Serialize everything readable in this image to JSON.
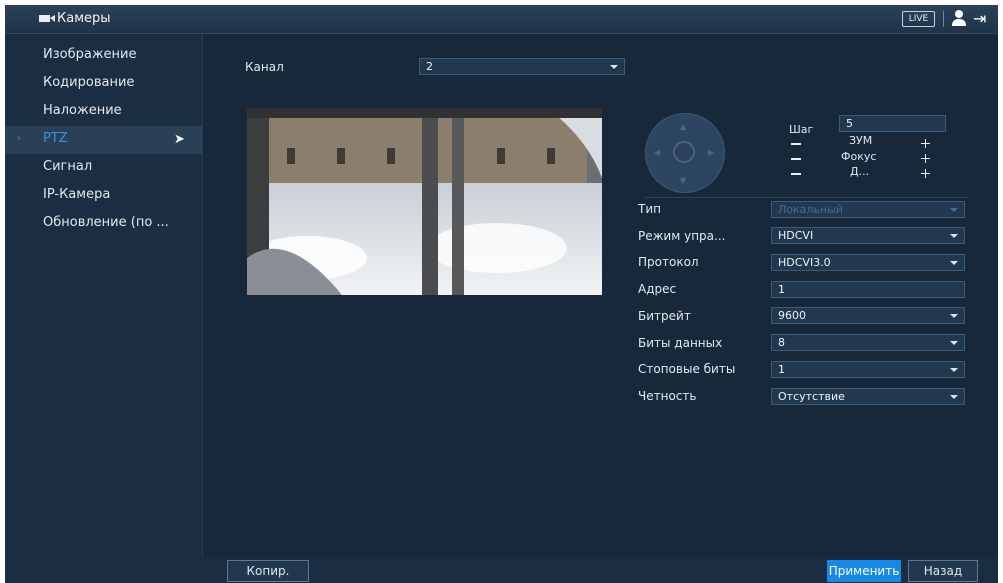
{
  "header": {
    "title": "Камеры",
    "live_label": "LIVE",
    "camera_icon": "video-camera-icon",
    "user_icon": "user-icon",
    "logout_icon": "logout-icon"
  },
  "sidebar": {
    "items": [
      {
        "label": "Изображение"
      },
      {
        "label": "Кодирование"
      },
      {
        "label": "Наложение"
      },
      {
        "label": "PTZ",
        "active": true
      },
      {
        "label": "Сигнал"
      },
      {
        "label": "IP-Камера"
      },
      {
        "label": "Обновление (по ..."
      }
    ]
  },
  "channel": {
    "label": "Канал",
    "value": "2"
  },
  "ptz_panel": {
    "step_label": "Шаг",
    "step_value": "5",
    "zoom_label": "ЗУМ",
    "focus_label": "Фокус",
    "iris_label": "Д..."
  },
  "form": {
    "type_label": "Тип",
    "type_value": "Локальный",
    "mode_label": "Режим упра...",
    "mode_value": "HDCVI",
    "protocol_label": "Протокол",
    "protocol_value": "HDCVI3.0",
    "address_label": "Адрес",
    "address_value": "1",
    "baud_label": "Битрейт",
    "baud_value": "9600",
    "databits_label": "Биты данных",
    "databits_value": "8",
    "stopbits_label": "Стоповые биты",
    "stopbits_value": "1",
    "parity_label": "Четность",
    "parity_value": "Отсутствие"
  },
  "buttons": {
    "copy": "Копир.",
    "apply": "Применить",
    "back": "Назад"
  },
  "colors": {
    "accent": "#1689e6",
    "active_text": "#3b8fe0",
    "background": "#17283a"
  }
}
